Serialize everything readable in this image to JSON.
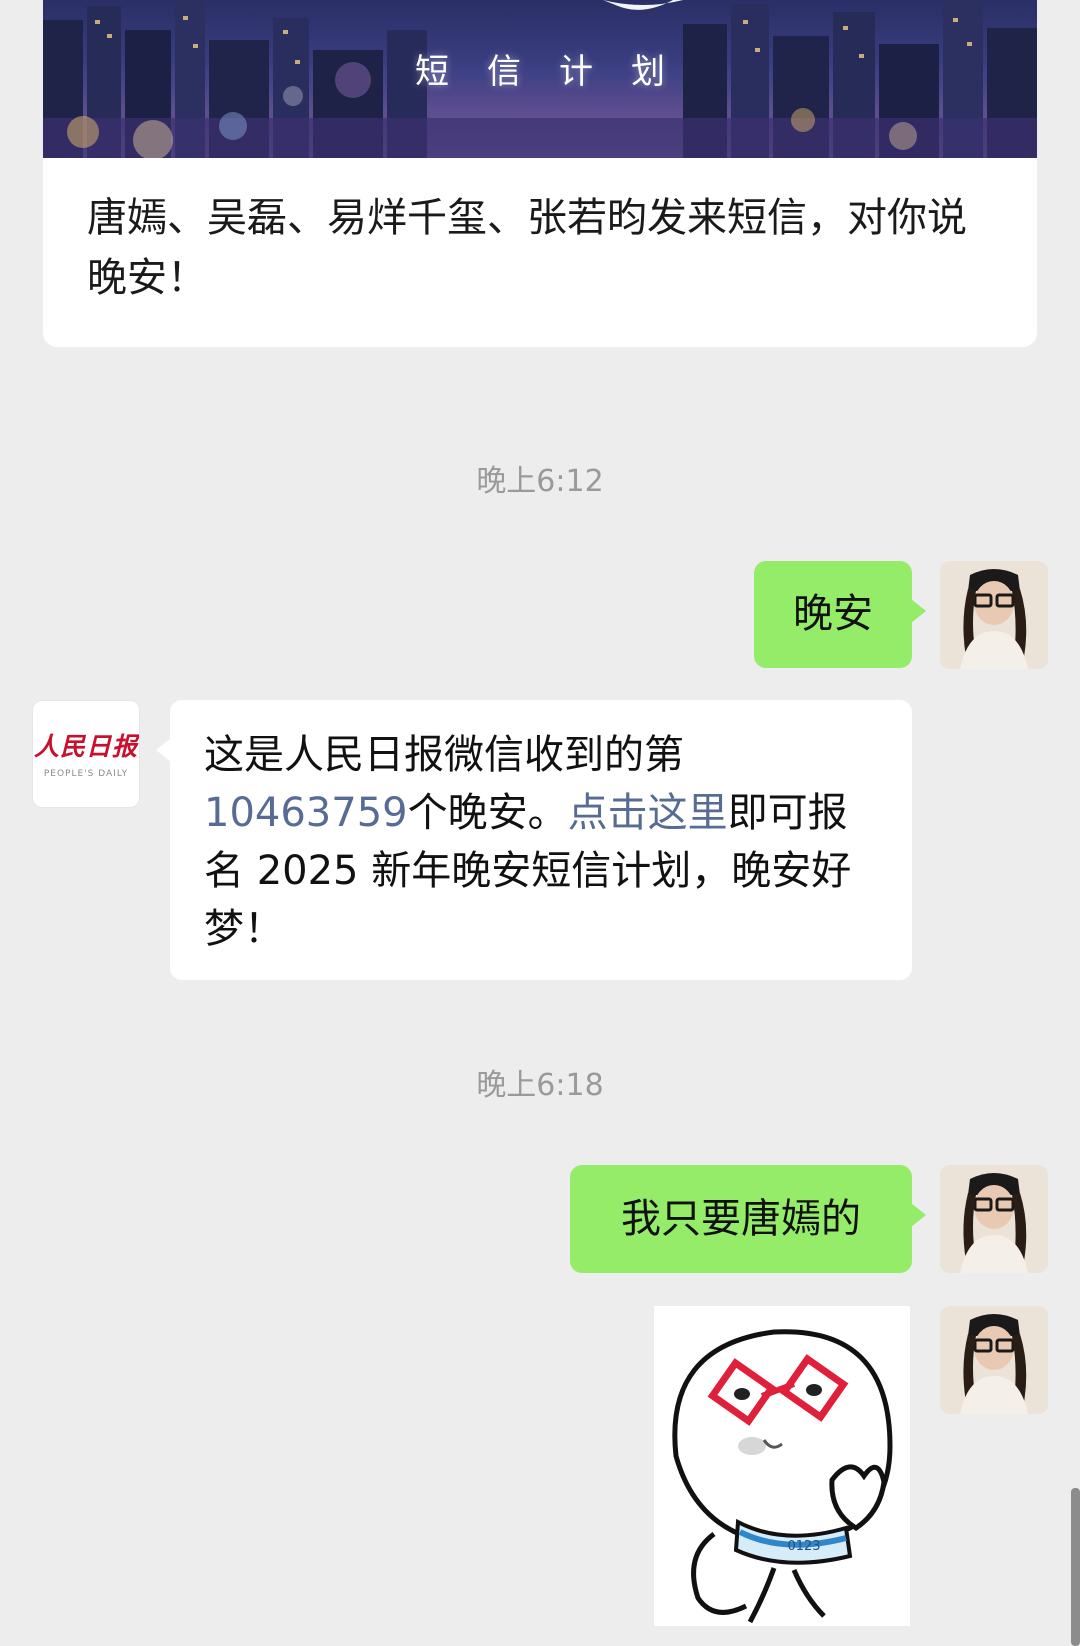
{
  "card": {
    "banner_caption": "短信计划",
    "text": "唐嫣、吴磊、易烊千玺、张若昀发来短信，对你说晚安！"
  },
  "timestamps": [
    "晚上6:12",
    "晚上6:18"
  ],
  "messages": {
    "m1": {
      "text": "晚安"
    },
    "m2": {
      "part1": "这是人民日报微信收到的第",
      "count": "10463759",
      "part2": "个晚安。",
      "link": "点击这里",
      "part3": "即可报名 2025 新年晚安短信计划，晚安好梦！"
    },
    "m3": {
      "text": "我只要唐嫣的"
    }
  },
  "avatar_pd": {
    "logo": "人民日报",
    "subtitle": "PEOPLE'S DAILY"
  },
  "sticker": {
    "shirt_text": "0123"
  },
  "colors": {
    "chat_bg": "#ededed",
    "bubble_green": "#95ec69",
    "bubble_white": "#ffffff",
    "link": "#576b95",
    "timestamp": "#9a9a9a",
    "pd_red": "#c8102e"
  }
}
